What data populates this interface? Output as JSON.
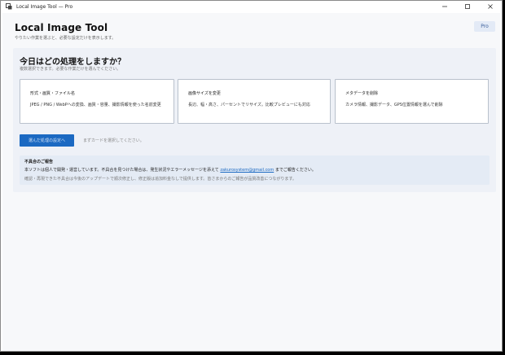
{
  "window": {
    "title": "Local Image Tool — Pro",
    "controls": [
      "minimize-icon",
      "maximize-icon",
      "close-icon"
    ]
  },
  "header": {
    "title": "Local Image Tool",
    "subtitle": "やりたい作業を選ぶと、必要な設定だけを表示します。",
    "badge": "Pro"
  },
  "task_panel": {
    "title": "今日はどの処理をしますか？",
    "subtitle": "複数選択できます。必要な作業だけを選んでください。",
    "cards": [
      {
        "title": "形式・画質・ファイル名",
        "description": "JPEG / PNG / WebPへの変換、画質・容量、撮影情報を使った名前変更"
      },
      {
        "title": "画像サイズを変更",
        "description": "長辺、幅・高さ、パーセントでリサイズ。比較プレビューにも対応"
      },
      {
        "title": "メタデータを削除",
        "description": "カメラ情報、撮影データ、GPS位置情報を選んで削除"
      }
    ],
    "primary_button": "選んだ処理の設定へ",
    "hint": "まずカードを選択してください。"
  },
  "report": {
    "title": "不具合のご報告",
    "line1_prefix": "本ソフトは個人で開発・運営しています。不具合を見つけた場合は、発生状況やエラーメッセージを添えて",
    "email": "zakurosystem@gmail.com",
    "line1_suffix": "までご報告ください。",
    "line2": "確認・再現できた不具合は今後のアップデートで順次修正し、修正版は追加料金なしで提供します。皆さまからのご報告が品質改善につながります。"
  },
  "colors": {
    "accent": "#1b69c2",
    "panel": "#eef1f7",
    "report_bg": "#e4ebf5",
    "badge_bg": "#e3eaf6"
  }
}
